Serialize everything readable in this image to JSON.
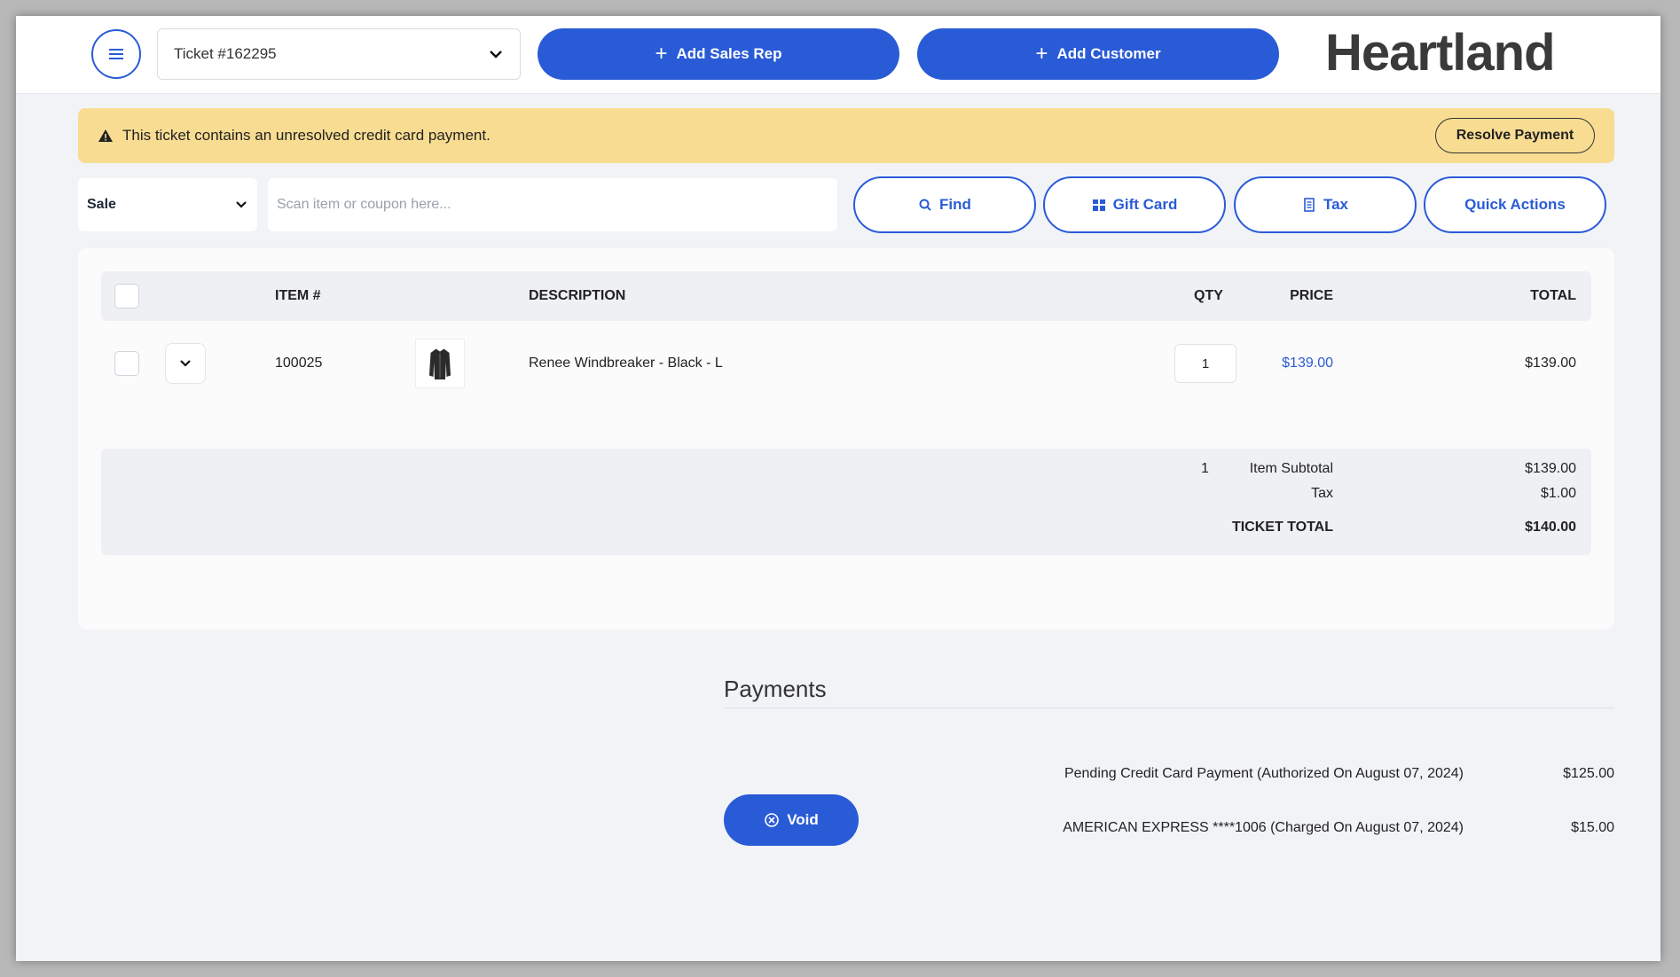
{
  "topbar": {
    "ticket_label": "Ticket #162295",
    "add_sales_rep": "Add Sales Rep",
    "add_customer": "Add Customer",
    "logo": "Heartland"
  },
  "alert": {
    "message": "This ticket contains an unresolved credit card payment.",
    "resolve_button": "Resolve Payment"
  },
  "actions": {
    "mode": "Sale",
    "scan_placeholder": "Scan item or coupon here...",
    "find": "Find",
    "gift_card": "Gift Card",
    "tax": "Tax",
    "quick_actions": "Quick Actions"
  },
  "table": {
    "headers": {
      "item": "ITEM #",
      "description": "DESCRIPTION",
      "price": "PRICE",
      "qty": "QTY",
      "total": "TOTAL"
    },
    "rows": [
      {
        "item": "100025",
        "description": "Renee Windbreaker - Black - L",
        "price": "$139.00",
        "qty": "1",
        "total": "$139.00"
      }
    ]
  },
  "summary": {
    "item_subtotal_label": "Item Subtotal",
    "item_subtotal_qty": "1",
    "item_subtotal_value": "$139.00",
    "tax_label": "Tax",
    "tax_value": "$1.00",
    "ticket_total_label": "TICKET TOTAL",
    "ticket_total_value": "$140.00"
  },
  "payments": {
    "title": "Payments",
    "void_button": "Void",
    "lines": [
      {
        "description": "Pending Credit Card Payment (Authorized On August 07, 2024)",
        "amount": "$125.00"
      },
      {
        "description": "AMERICAN EXPRESS ****1006 (Charged On August 07, 2024)",
        "amount": "$15.00"
      }
    ]
  },
  "colors": {
    "accent": "#2a5bd7",
    "alert_bg": "#f8dc92"
  }
}
